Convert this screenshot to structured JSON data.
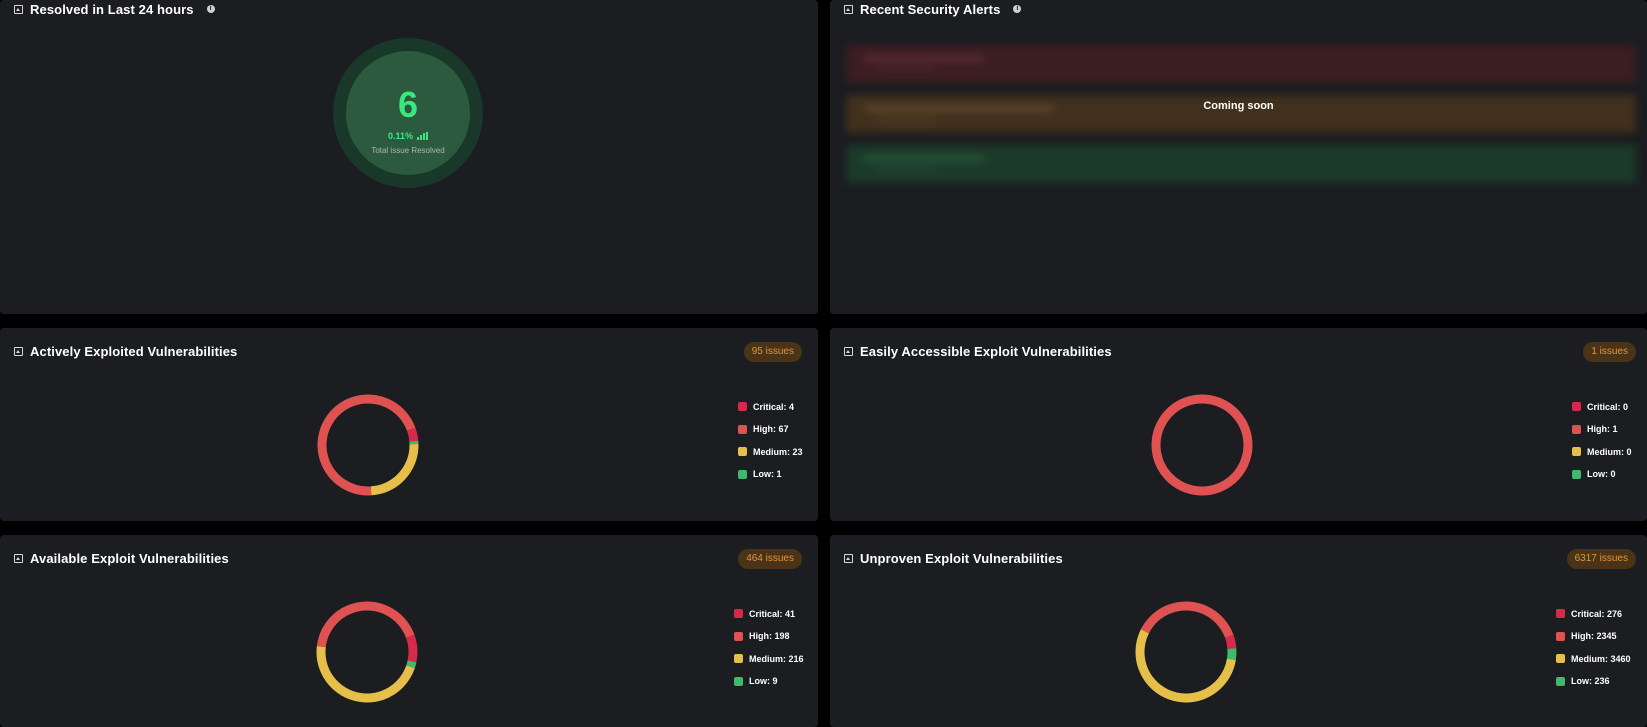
{
  "resolved": {
    "title": "Resolved in Last 24 hours",
    "count": "6",
    "percent": "0.11%",
    "label": "Total issue Resolved"
  },
  "alerts": {
    "title": "Recent Security Alerts",
    "coming_soon": "Coming soon",
    "row_colors": [
      "#3b1d22",
      "#40301d",
      "#1c3a2a"
    ]
  },
  "colors": {
    "critical": "#d62a4a",
    "high": "#e05252",
    "medium": "#e6bf4a",
    "low": "#3fb96b",
    "badge_text": "#e8923a"
  },
  "widgets": [
    {
      "title": "Actively Exploited Vulnerabilities",
      "badge": "95 issues",
      "legend": [
        "Critical: 4",
        "High: 67",
        "Medium: 23",
        "Low: 1"
      ],
      "values": {
        "critical": 4,
        "high": 67,
        "medium": 23,
        "low": 1
      }
    },
    {
      "title": "Easily Accessible Exploit Vulnerabilities",
      "badge": "1 issues",
      "legend": [
        "Critical: 0",
        "High: 1",
        "Medium: 0",
        "Low: 0"
      ],
      "values": {
        "critical": 0,
        "high": 1,
        "medium": 0,
        "low": 0
      }
    },
    {
      "title": "Available Exploit Vulnerabilities",
      "badge": "464 issues",
      "legend": [
        "Critical: 41",
        "High: 198",
        "Medium: 216",
        "Low: 9"
      ],
      "values": {
        "critical": 41,
        "high": 198,
        "medium": 216,
        "low": 9
      }
    },
    {
      "title": "Unproven Exploit Vulnerabilities",
      "badge": "6317 issues",
      "legend": [
        "Critical: 276",
        "High: 2345",
        "Medium: 3460",
        "Low: 236"
      ],
      "values": {
        "critical": 276,
        "high": 2345,
        "medium": 3460,
        "low": 236
      }
    }
  ]
}
